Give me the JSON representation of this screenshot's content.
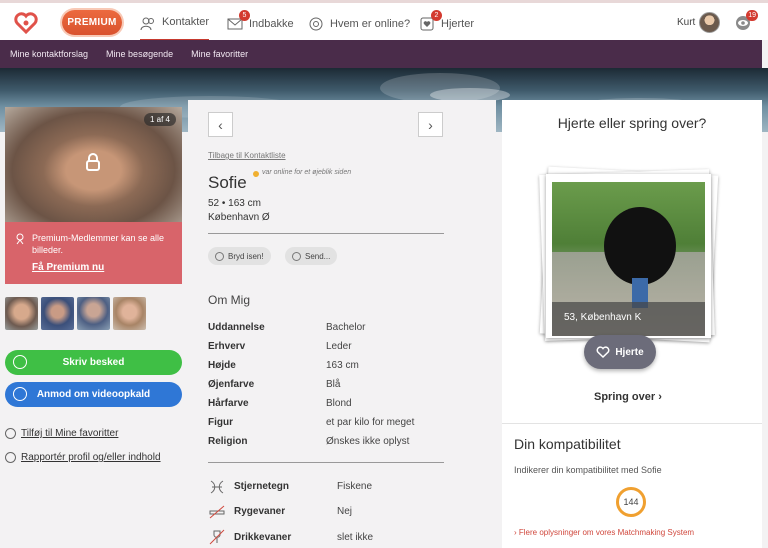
{
  "topbar": {
    "premium_label": "PREMIUM",
    "nav": [
      {
        "label": "Kontakter",
        "icon": "contacts-icon",
        "badge": ""
      },
      {
        "label": "Indbakke",
        "icon": "mail-icon",
        "badge": "5"
      },
      {
        "label": "Hvem er online?",
        "icon": "online-icon",
        "badge": ""
      },
      {
        "label": "Hjerter",
        "icon": "hearts-icon",
        "badge": "2"
      }
    ],
    "user_name": "Kurt",
    "views_badge": "19"
  },
  "subnav": [
    "Mine kontaktforslag",
    "Mine besøgende",
    "Mine favoritter"
  ],
  "left": {
    "photo_counter": "1 af 4",
    "premium_text": "Premium-Medlemmer kan se alle billeder.",
    "premium_link": "Få Premium nu",
    "write_button": "Skriv besked",
    "video_button": "Anmod om videoopkald",
    "fav_link": "Tilføj til Mine favoritter",
    "report_link": "Rapportér profil og/eller indhold"
  },
  "profile": {
    "back_link": "Tilbage til Kontaktliste",
    "name": "Sofie",
    "online_text": "var online for et øjeblik siden",
    "age_height": "52 • 163 cm",
    "location": "København Ø",
    "chip_ice": "Bryd isen!",
    "chip_send": "Send...",
    "about_title": "Om Mig",
    "facts": [
      {
        "label": "Uddannelse",
        "value": "Bachelor"
      },
      {
        "label": "Erhverv",
        "value": "Leder"
      },
      {
        "label": "Højde",
        "value": "163 cm"
      },
      {
        "label": "Øjenfarve",
        "value": "Blå"
      },
      {
        "label": "Hårfarve",
        "value": "Blond"
      },
      {
        "label": "Figur",
        "value": "et par kilo for meget"
      },
      {
        "label": "Religion",
        "value": "Ønskes ikke oplyst"
      }
    ],
    "traits": [
      {
        "label": "Stjernetegn",
        "value": "Fiskene",
        "icon": "pisces-icon"
      },
      {
        "label": "Rygevaner",
        "value": "Nej",
        "icon": "no-smoking-icon"
      },
      {
        "label": "Drikkevaner",
        "value": "slet ikke",
        "icon": "no-drinking-icon"
      }
    ]
  },
  "match": {
    "title": "Hjerte eller spring over?",
    "caption": "53, København K",
    "heart_button": "Hjerte",
    "skip_link": "Spring over",
    "compat_title": "Din kompatibilitet",
    "compat_sub": "Indikerer din kompatibilitet med Sofie",
    "score": "144",
    "more_link": "Flere oplysninger om vores Matchmaking System"
  }
}
